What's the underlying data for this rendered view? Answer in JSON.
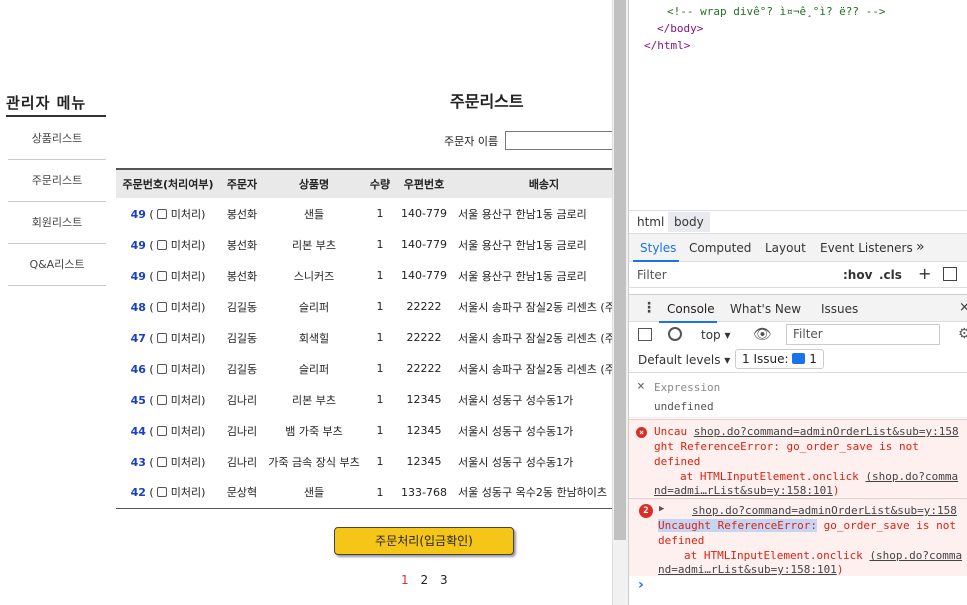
{
  "sidebar": {
    "title": "관리자 메뉴",
    "items": [
      {
        "label": "상품리스트"
      },
      {
        "label": "주문리스트"
      },
      {
        "label": "회원리스트"
      },
      {
        "label": "Q&A리스트"
      }
    ]
  },
  "main": {
    "title": "주문리스트",
    "search_label": "주문자 이름",
    "search_value": "",
    "columns": [
      "주문번호(처리여부)",
      "주문자",
      "상품명",
      "수량",
      "우편번호",
      "배송지"
    ],
    "status_label": "미처리",
    "rows": [
      {
        "num": "49",
        "orderer": "봉선화",
        "product": "샌들",
        "qty": "1",
        "zip": "140-779",
        "addr": "서울 용산구 한남1동 금로리"
      },
      {
        "num": "49",
        "orderer": "봉선화",
        "product": "리본 부츠",
        "qty": "1",
        "zip": "140-779",
        "addr": "서울 용산구 한남1동 금로리"
      },
      {
        "num": "49",
        "orderer": "봉선화",
        "product": "스니커즈",
        "qty": "1",
        "zip": "140-779",
        "addr": "서울 용산구 한남1동 금로리"
      },
      {
        "num": "48",
        "orderer": "김길동",
        "product": "슬리퍼",
        "qty": "1",
        "zip": "22222",
        "addr": "서울시 송파구 잠실2동 리센츠 (주"
      },
      {
        "num": "47",
        "orderer": "김길동",
        "product": "회색힐",
        "qty": "1",
        "zip": "22222",
        "addr": "서울시 송파구 잠실2동 리센츠 (주"
      },
      {
        "num": "46",
        "orderer": "김길동",
        "product": "슬리퍼",
        "qty": "1",
        "zip": "22222",
        "addr": "서울시 송파구 잠실2동 리센츠 (주"
      },
      {
        "num": "45",
        "orderer": "김나리",
        "product": "리본 부츠",
        "qty": "1",
        "zip": "12345",
        "addr": "서울시 성동구 성수동1가"
      },
      {
        "num": "44",
        "orderer": "김나리",
        "product": "뱀 가죽 부츠",
        "qty": "1",
        "zip": "12345",
        "addr": "서울시 성동구 성수동1가"
      },
      {
        "num": "43",
        "orderer": "김나리",
        "product": "가죽 금속 장식 부츠",
        "qty": "1",
        "zip": "12345",
        "addr": "서울시 성동구 성수동1가"
      },
      {
        "num": "42",
        "orderer": "문상혁",
        "product": "샌들",
        "qty": "1",
        "zip": "133-768",
        "addr": "서울 성동구 옥수2동 한남하이츠"
      }
    ],
    "process_button": "주문처리(입금확인)",
    "pages": [
      "1",
      "2",
      "3"
    ],
    "active_page": "1"
  },
  "devtools": {
    "source_lines": [
      {
        "text": "<!-- wrap divê°? ì¤¬ê¸°ì? ë?? -->",
        "kind": "comment"
      },
      {
        "text": "</body>",
        "kind": "tag"
      },
      {
        "text": "</html>",
        "kind": "tag"
      }
    ],
    "breadcrumb": [
      "html",
      "body"
    ],
    "styles_tabs": [
      "Styles",
      "Computed",
      "Layout",
      "Event Listeners",
      "»"
    ],
    "styles_filter_placeholder": "Filter",
    "hov_label": ":hov",
    "cls_label": ".cls",
    "drawer_tabs": [
      "Console",
      "What's New",
      "Issues"
    ],
    "context_label": "top",
    "console_filter_placeholder": "Filter",
    "levels_label": "Default levels",
    "issues_label": "1 Issue:",
    "issues_count": "1",
    "expression_label": "Expression",
    "expression_value": "undefined",
    "error1": {
      "prefix": "Uncau",
      "link": "shop.do?command=adminOrderList&sub=y:158",
      "line2": "ght ReferenceError: go_order_save is not",
      "line3": "defined",
      "line4": "at HTMLInputElement.onclick",
      "link2a": "(shop.do?comma",
      "link2b": "nd=admi…rList&sub=y:158:101",
      "link2c": ")"
    },
    "error2": {
      "count": "2",
      "link": "shop.do?command=adminOrderList&sub=y:158",
      "highlight": "Uncaught ReferenceError:",
      "rest": "go_order_save is not",
      "line3": "defined",
      "line4": "at HTMLInputElement.onclick",
      "link2a": "(shop.do?comma",
      "link2b": "nd=admi…rList&sub=y:158:101",
      "link2c": ")"
    },
    "prompt": "›"
  }
}
